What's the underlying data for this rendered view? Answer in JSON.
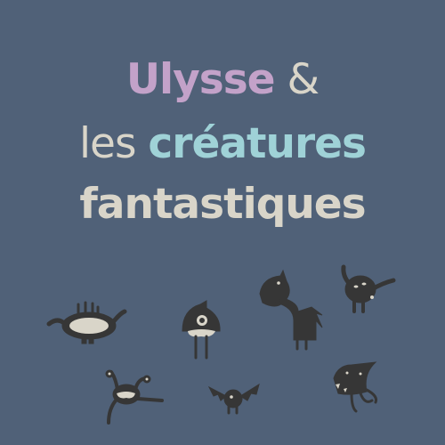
{
  "title": {
    "line1": {
      "name": "Ulysse",
      "amp": "&"
    },
    "line2": {
      "prefix": "les",
      "highlight": "créatures"
    },
    "line3": "fantastiques"
  },
  "colors": {
    "background": "#506178",
    "name": "#c3a2c9",
    "highlight": "#9fd2d7",
    "text": "#d9d5c9",
    "creature": "#363636"
  }
}
